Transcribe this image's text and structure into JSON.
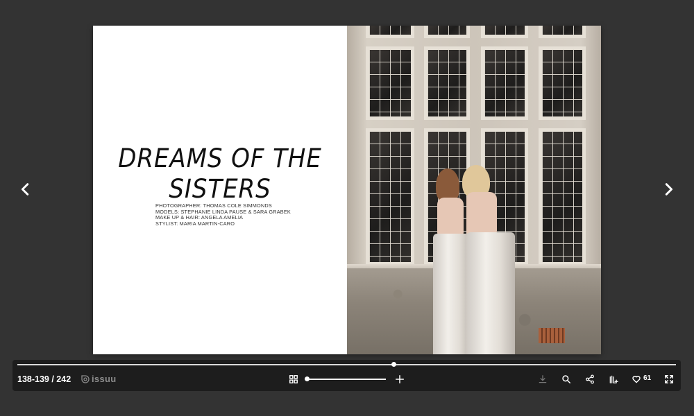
{
  "magazine": {
    "headline_line1": "DREAMS OF THE",
    "headline_line2": "SISTERS",
    "credits": [
      "PHOTOGRAPHER: THOMAS COLE SIMMONDS",
      "MODELS: STEPHANIE LINDA PAUSE & SARA GRABEK",
      "MAKE UP & HAIR: ANGELA AMELIA",
      "STYLIST: MARIA MARTIN-CARO"
    ]
  },
  "toolbar": {
    "page_count": "138-139 / 242",
    "brand": "issuu",
    "reading_progress_fraction": 0.572,
    "like_count": "61"
  },
  "icons": {
    "prev": "chevron-left-icon",
    "next": "chevron-right-icon",
    "grid": "grid-icon",
    "zoom_in": "plus-icon",
    "download": "download-icon",
    "search": "search-icon",
    "share": "share-icon",
    "add_to_stack": "add-to-stack-icon",
    "like": "heart-icon",
    "fullscreen": "fullscreen-icon"
  },
  "colors": {
    "background": "#333333",
    "toolbar": "#1d1d1d",
    "accent": "#ffffff",
    "brand": "#8c8c8c"
  }
}
